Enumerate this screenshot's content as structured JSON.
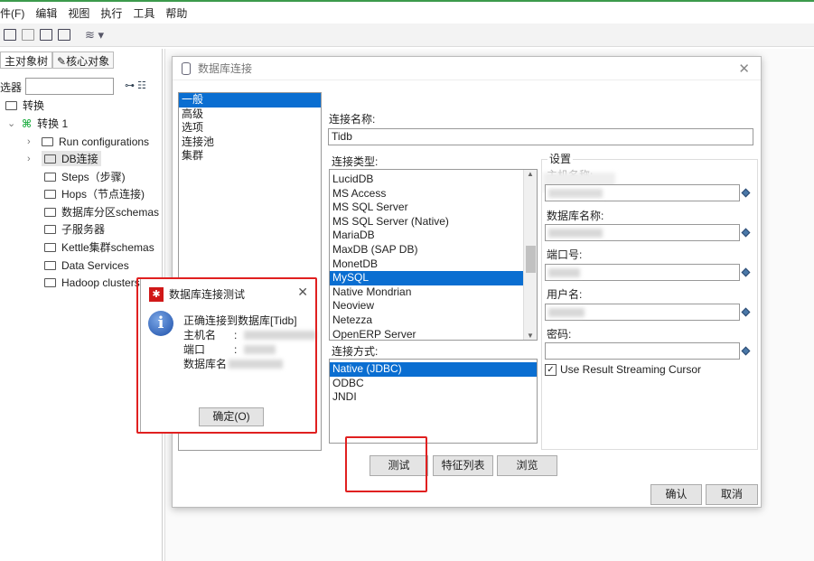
{
  "menu": [
    "件(F)",
    "编辑",
    "视图",
    "执行",
    "工具",
    "帮助"
  ],
  "left": {
    "tabs": [
      "主对象树",
      "核心对象"
    ],
    "filter_label": "选器",
    "tree": [
      {
        "label": "转换"
      },
      {
        "label": "转换 1"
      },
      {
        "label": "Run configurations"
      },
      {
        "label": "DB连接"
      },
      {
        "label": "Steps（步骤)"
      },
      {
        "label": "Hops（节点连接)"
      },
      {
        "label": "数据库分区schemas"
      },
      {
        "label": "子服务器"
      },
      {
        "label": "Kettle集群schemas"
      },
      {
        "label": "Data Services"
      },
      {
        "label": "Hadoop clusters"
      }
    ]
  },
  "dialog": {
    "title": "数据库连接",
    "categories": [
      "一般",
      "高级",
      "选项",
      "连接池",
      "集群"
    ],
    "selected_category": "一般",
    "conn_name_label": "连接名称:",
    "conn_name_value": "Tidb",
    "conn_type_label": "连接类型:",
    "conn_types": [
      "LucidDB",
      "MS Access",
      "MS SQL Server",
      "MS SQL Server (Native)",
      "MariaDB",
      "MaxDB (SAP DB)",
      "MonetDB",
      "MySQL",
      "Native Mondrian",
      "Neoview",
      "Netezza",
      "OpenERP Server"
    ],
    "selected_type": "MySQL",
    "access_label": "连接方式:",
    "access_types": [
      "Native (JDBC)",
      "ODBC",
      "JNDI"
    ],
    "selected_access": "Native (JDBC)",
    "settings_label": "设置",
    "fields": [
      {
        "label": "主机名称:"
      },
      {
        "label": "数据库名称:"
      },
      {
        "label": "端口号:"
      },
      {
        "label": "用户名:"
      },
      {
        "label": "密码:"
      }
    ],
    "streaming_cursor_label": "Use Result Streaming Cursor",
    "streaming_cursor_checked": true,
    "buttons": {
      "test": "测试",
      "features": "特征列表",
      "browse": "浏览",
      "ok": "确认",
      "cancel": "取消"
    }
  },
  "popup": {
    "title": "数据库连接测试",
    "message": "正确连接到数据库[Tidb]",
    "host_label": "主机名",
    "port_label": "端口",
    "db_label": "数据库名",
    "colon": ":",
    "ok": "确定(O)"
  },
  "colors": {
    "selection": "#0a6ed1",
    "highlight": "#e02020"
  }
}
